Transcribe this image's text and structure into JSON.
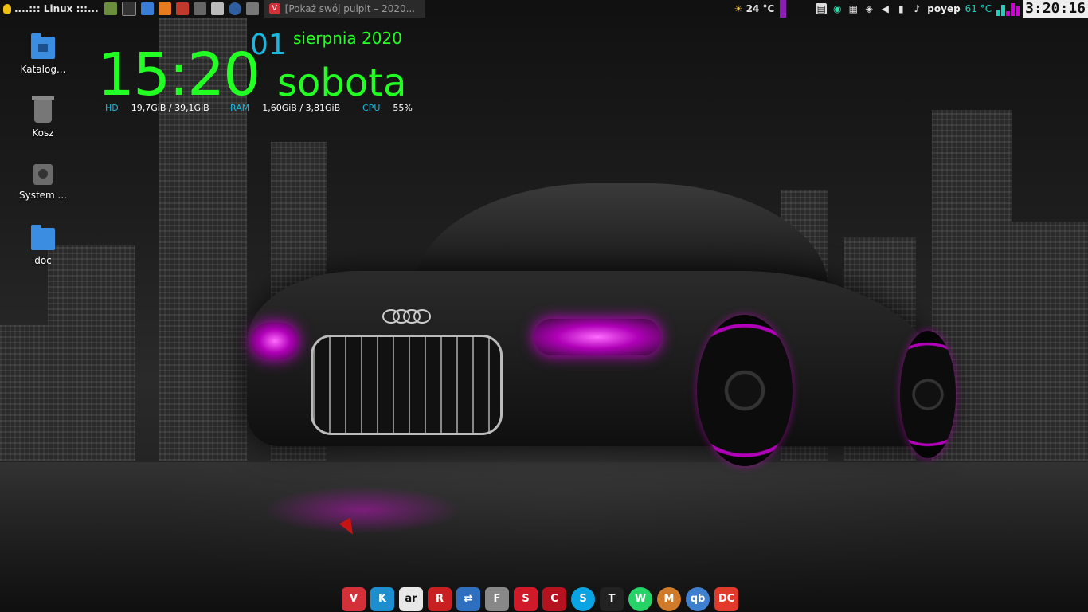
{
  "top_panel": {
    "menu_label": "....::: Linux :::...",
    "window_title": "[Pokaż swój pulpit – 2020...",
    "weather": "24 °C",
    "temperature": "61 °C",
    "username": "poyep",
    "clock": "3:20:16",
    "launchers": [
      "file-manager-icon",
      "terminal-icon",
      "calculator-icon",
      "sublime-text-icon",
      "screen-recorder-icon",
      "downloader-icon",
      "screenshot-icon",
      "network-icon",
      "link-icon"
    ],
    "tray_icons": [
      "ghost-icon",
      "image-icon",
      "wifi-icon",
      "volume-icon",
      "battery-icon",
      "bell-icon"
    ]
  },
  "desktop_icons": [
    {
      "label": "Katalog...",
      "icon": "home-folder-icon"
    },
    {
      "label": "Kosz",
      "icon": "trash-icon"
    },
    {
      "label": "System ...",
      "icon": "hard-disk-icon"
    },
    {
      "label": "doc",
      "icon": "folder-icon"
    }
  ],
  "conky": {
    "time": "15:20",
    "day": "01",
    "month_year": "sierpnia 2020",
    "weekday": "sobota",
    "hd_label": "HD",
    "hd_value": "19,7GiB / 39,1GiB",
    "ram_label": "RAM",
    "ram_value": "1,60GiB / 3,81GiB",
    "cpu_label": "CPU",
    "cpu_value": "55%"
  },
  "dock": {
    "items": [
      {
        "name": "vivaldi-icon",
        "glyph": "V",
        "color": "#d4303a"
      },
      {
        "name": "kodi-icon",
        "glyph": "K",
        "color": "#1d8fd0"
      },
      {
        "name": "ar-icon",
        "glyph": "ar",
        "color": "#e8e8e8"
      },
      {
        "name": "rabbit-icon",
        "glyph": "R",
        "color": "#c82020"
      },
      {
        "name": "arrow-app-icon",
        "glyph": "⇄",
        "color": "#2f6fc0"
      },
      {
        "name": "film-icon",
        "glyph": "F",
        "color": "#888888"
      },
      {
        "name": "strawberry-icon",
        "glyph": "S",
        "color": "#d01a2a"
      },
      {
        "name": "cherry-icon",
        "glyph": "C",
        "color": "#b3121e"
      },
      {
        "name": "skype-icon",
        "glyph": "S",
        "color": "#0aa3e4"
      },
      {
        "name": "tux-icon",
        "glyph": "T",
        "color": "#222222"
      },
      {
        "name": "whatsapp-icon",
        "glyph": "W",
        "color": "#25d366"
      },
      {
        "name": "monkey-icon",
        "glyph": "M",
        "color": "#d07b2a"
      },
      {
        "name": "qbittorrent-icon",
        "glyph": "qb",
        "color": "#3f7fcf"
      },
      {
        "name": "double-commander-icon",
        "glyph": "DC",
        "color": "#e23a2a"
      }
    ]
  }
}
